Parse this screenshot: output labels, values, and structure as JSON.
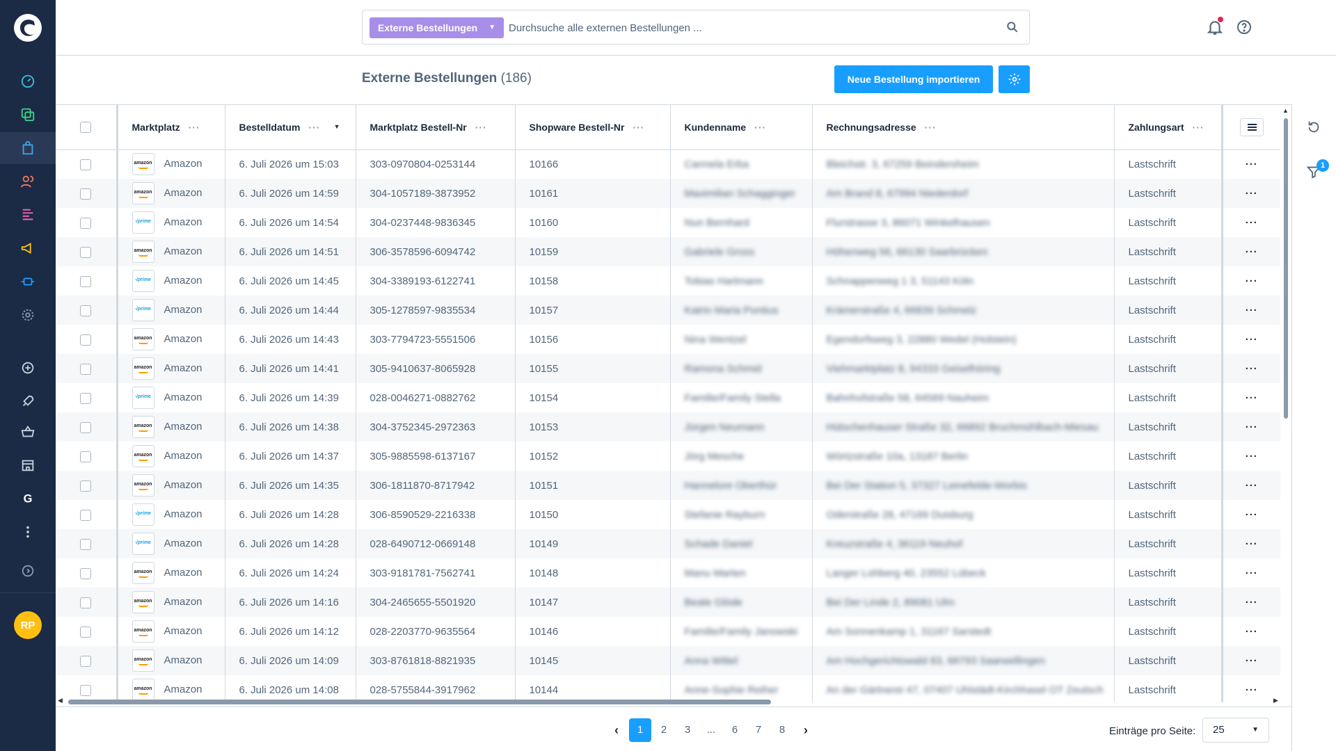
{
  "colors": {
    "sidebar": "#1b2a45",
    "primary": "#189eff",
    "search_type_bg": "#a78ee8",
    "avatar": "#ffc012"
  },
  "sidebar": {
    "items": [
      "dashboard-icon",
      "catalogue-icon",
      "orders-icon",
      "customers-icon",
      "content-icon",
      "marketing-icon",
      "extensions-icon",
      "settings-icon",
      "add-icon",
      "rocket-icon",
      "basket-icon",
      "store-icon",
      "google-icon",
      "more-icon",
      "expand-icon"
    ],
    "avatar_initials": "RP"
  },
  "header": {
    "search_type": "Externe Bestellungen",
    "search_placeholder": "Durchsuche alle externen Bestellungen ..."
  },
  "page": {
    "title": "Externe Bestellungen",
    "count": "(186)",
    "import_button": "Neue Bestellung importieren"
  },
  "table": {
    "columns": [
      "Marktplatz",
      "Bestelldatum",
      "Marktplatz Bestell-Nr",
      "Shopware Bestell-Nr",
      "Kundenname",
      "Rechnungsadresse",
      "Zahlungsart"
    ],
    "rows": [
      {
        "logo": "amazon",
        "marketplace": "Amazon",
        "date": "6. Juli 2026 um 15:03",
        "mp_nr": "303-0970804-0253144",
        "sw_nr": "10166",
        "name": "Carmela Erba",
        "address": "Bleichstr. 3, 67259 Beindersheim",
        "payment": "Lastschrift"
      },
      {
        "logo": "amazon",
        "marketplace": "Amazon",
        "date": "6. Juli 2026 um 14:59",
        "mp_nr": "304-1057189-3873952",
        "sw_nr": "10161",
        "name": "Maximilian Schagginger",
        "address": "Am Brand 8, 67994 Niederdorf",
        "payment": "Lastschrift"
      },
      {
        "logo": "prime",
        "marketplace": "Amazon",
        "date": "6. Juli 2026 um 14:54",
        "mp_nr": "304-0237448-9836345",
        "sw_nr": "10160",
        "name": "Nun Bernhard",
        "address": "Flurstrasse 3, 86071 Winkelhausen",
        "payment": "Lastschrift"
      },
      {
        "logo": "amazon",
        "marketplace": "Amazon",
        "date": "6. Juli 2026 um 14:51",
        "mp_nr": "306-3578596-6094742",
        "sw_nr": "10159",
        "name": "Gabriele Gross",
        "address": "Höhenweg 56, 66130 Saarbrücken",
        "payment": "Lastschrift"
      },
      {
        "logo": "prime",
        "marketplace": "Amazon",
        "date": "6. Juli 2026 um 14:45",
        "mp_nr": "304-3389193-6122741",
        "sw_nr": "10158",
        "name": "Tobias Hartmann",
        "address": "Schnappenweg 1 3, 51143 Köln",
        "payment": "Lastschrift"
      },
      {
        "logo": "prime",
        "marketplace": "Amazon",
        "date": "6. Juli 2026 um 14:44",
        "mp_nr": "305-1278597-9835534",
        "sw_nr": "10157",
        "name": "Katrin Maria Pontius",
        "address": "Krämerstraße 4, 66839 Schmelz",
        "payment": "Lastschrift"
      },
      {
        "logo": "amazon",
        "marketplace": "Amazon",
        "date": "6. Juli 2026 um 14:43",
        "mp_nr": "303-7794723-5551506",
        "sw_nr": "10156",
        "name": "Nina Wentzel",
        "address": "Egendorfsweg 3, 22880 Wedel (Holstein)",
        "payment": "Lastschrift"
      },
      {
        "logo": "amazon",
        "marketplace": "Amazon",
        "date": "6. Juli 2026 um 14:41",
        "mp_nr": "305-9410637-8065928",
        "sw_nr": "10155",
        "name": "Ramona Schmid",
        "address": "Viehmarktplatz 8, 94333 Geiselhöring",
        "payment": "Lastschrift"
      },
      {
        "logo": "prime",
        "marketplace": "Amazon",
        "date": "6. Juli 2026 um 14:39",
        "mp_nr": "028-0046271-0882762",
        "sw_nr": "10154",
        "name": "Familie/Family Stella",
        "address": "Bahnhofstraße 58, 64569 Nauheim",
        "payment": "Lastschrift"
      },
      {
        "logo": "amazon",
        "marketplace": "Amazon",
        "date": "6. Juli 2026 um 14:38",
        "mp_nr": "304-3752345-2972363",
        "sw_nr": "10153",
        "name": "Jürgen Neumann",
        "address": "Hütschenhauser Straße 32, 66892 Bruchmühlbach-Miesau",
        "payment": "Lastschrift"
      },
      {
        "logo": "amazon",
        "marketplace": "Amazon",
        "date": "6. Juli 2026 um 14:37",
        "mp_nr": "305-9885598-6137167",
        "sw_nr": "10152",
        "name": "Jörg Mesche",
        "address": "Wörtzstraße 10a, 13187 Berlin",
        "payment": "Lastschrift"
      },
      {
        "logo": "amazon",
        "marketplace": "Amazon",
        "date": "6. Juli 2026 um 14:35",
        "mp_nr": "306-1811870-8717942",
        "sw_nr": "10151",
        "name": "Hannelore Oberthür",
        "address": "Bei Der Station 5, 37327 Leinefelde-Worbis",
        "payment": "Lastschrift"
      },
      {
        "logo": "prime",
        "marketplace": "Amazon",
        "date": "6. Juli 2026 um 14:28",
        "mp_nr": "306-8590529-2216338",
        "sw_nr": "10150",
        "name": "Stefanie Rayburn",
        "address": "Oderstraße 28, 47169 Duisburg",
        "payment": "Lastschrift"
      },
      {
        "logo": "prime",
        "marketplace": "Amazon",
        "date": "6. Juli 2026 um 14:28",
        "mp_nr": "028-6490712-0669148",
        "sw_nr": "10149",
        "name": "Schade Daniel",
        "address": "Kreuzstraße 4, 36119 Neuhof",
        "payment": "Lastschrift"
      },
      {
        "logo": "amazon",
        "marketplace": "Amazon",
        "date": "6. Juli 2026 um 14:24",
        "mp_nr": "303-9181781-7562741",
        "sw_nr": "10148",
        "name": "Manu Marten",
        "address": "Langer Lohberg 40, 23552 Lübeck",
        "payment": "Lastschrift"
      },
      {
        "logo": "amazon",
        "marketplace": "Amazon",
        "date": "6. Juli 2026 um 14:16",
        "mp_nr": "304-2465655-5501920",
        "sw_nr": "10147",
        "name": "Beate Glöde",
        "address": "Bei Der Linde 2, 89081 Ulm",
        "payment": "Lastschrift"
      },
      {
        "logo": "amazon",
        "marketplace": "Amazon",
        "date": "6. Juli 2026 um 14:12",
        "mp_nr": "028-2203770-9635564",
        "sw_nr": "10146",
        "name": "Familie/Family Janowski",
        "address": "Am Sonnenkamp 1, 31167 Sarstedt",
        "payment": "Lastschrift"
      },
      {
        "logo": "amazon",
        "marketplace": "Amazon",
        "date": "6. Juli 2026 um 14:09",
        "mp_nr": "303-8761818-8821935",
        "sw_nr": "10145",
        "name": "Anna Wittel",
        "address": "Am Hochgerichtswald 83, 66793 Saarwellingen",
        "payment": "Lastschrift"
      },
      {
        "logo": "amazon",
        "marketplace": "Amazon",
        "date": "6. Juli 2026 um 14:08",
        "mp_nr": "028-5755844-3917962",
        "sw_nr": "10144",
        "name": "Anne-Sophie Reiher",
        "address": "An der Gärtnerei 47, 07407 Uhlstädt-Kirchhasel OT Zeutsch",
        "payment": "Lastschrift"
      }
    ]
  },
  "pagination": {
    "prev": "‹",
    "pages": [
      "1",
      "2",
      "3",
      "...",
      "6",
      "7",
      "8"
    ],
    "current": "1",
    "next": "›",
    "per_page_label": "Einträge pro Seite:",
    "per_page_value": "25"
  },
  "rightbar": {
    "filter_badge": "1"
  },
  "logo_text": {
    "amazon": "amazon",
    "prime": "√prime"
  }
}
